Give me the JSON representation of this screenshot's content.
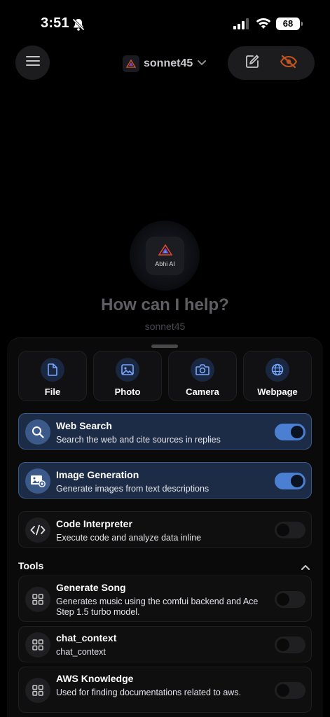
{
  "status_bar": {
    "time": "3:51",
    "battery": "68"
  },
  "header": {
    "menu_icon": "hamburger-icon",
    "model_name": "sonnet45",
    "compose_icon": "compose-icon",
    "incognito_icon": "eye-slash-icon",
    "accent_color": "#c2541f"
  },
  "hero": {
    "logo_text": "Abhi AI",
    "headline": "How can I help?",
    "model_label": "sonnet45"
  },
  "quick_actions": [
    {
      "label": "File",
      "icon": "file-icon"
    },
    {
      "label": "Photo",
      "icon": "photo-icon"
    },
    {
      "label": "Camera",
      "icon": "camera-icon"
    },
    {
      "label": "Webpage",
      "icon": "globe-icon"
    }
  ],
  "features": [
    {
      "title": "Web Search",
      "description": "Search the web and cite sources in replies",
      "enabled": true,
      "icon": "search-icon"
    },
    {
      "title": "Image Generation",
      "description": "Generate images from text descriptions",
      "enabled": true,
      "icon": "image-generation-icon"
    },
    {
      "title": "Code Interpreter",
      "description": "Execute code and analyze data inline",
      "enabled": false,
      "icon": "code-icon"
    }
  ],
  "tools": {
    "title": "Tools",
    "items": [
      {
        "title": "Generate Song",
        "description": "Generates music using the comfui backend and Ace Step 1.5 turbo model.",
        "enabled": false,
        "icon": "grid-icon"
      },
      {
        "title": "chat_context",
        "description": "chat_context",
        "enabled": false,
        "icon": "grid-icon"
      },
      {
        "title": "AWS Knowledge",
        "description": "Used for finding documentations related to aws.",
        "enabled": false,
        "icon": "grid-icon"
      }
    ]
  },
  "colors": {
    "toggle_on": "#4a7fd1",
    "card_active": "#1c2c47",
    "card_active_border": "#3a5a8e"
  }
}
